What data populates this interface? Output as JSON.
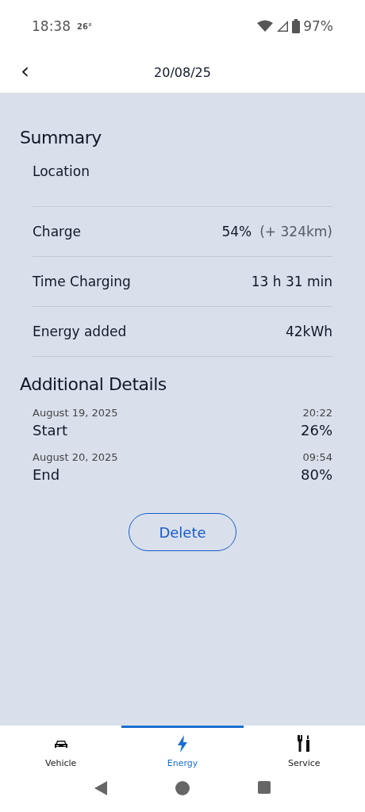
{
  "status_bar": {
    "time": "18:38",
    "temperature": "26°",
    "battery": "97%"
  },
  "header": {
    "back": "‹",
    "title": "20/08/25"
  },
  "summary": {
    "title": "Summary",
    "location_label": "Location",
    "rows": [
      {
        "label": "Charge",
        "value": "54%",
        "extra": "(+ 324km)"
      },
      {
        "label": "Time Charging",
        "value": "13 h 31 min"
      },
      {
        "label": "Energy added",
        "value": "42kWh"
      }
    ]
  },
  "details": {
    "title": "Additional Details",
    "entries": [
      {
        "date": "August 19, 2025",
        "time": "20:22",
        "label": "Start",
        "value": "26%"
      },
      {
        "date": "August 20, 2025",
        "time": "09:54",
        "label": "End",
        "value": "80%"
      }
    ]
  },
  "delete_button": "Delete",
  "nav": [
    {
      "kind": "vehicle",
      "label": "Vehicle",
      "selected": false
    },
    {
      "kind": "energy",
      "label": "Energy",
      "selected": true
    },
    {
      "kind": "service",
      "label": "Service",
      "selected": false
    }
  ]
}
